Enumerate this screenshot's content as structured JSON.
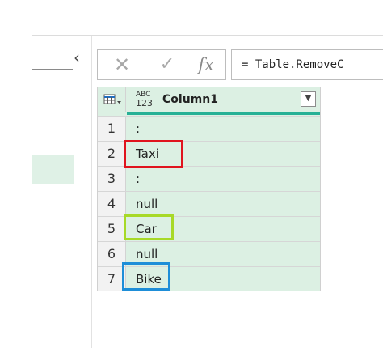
{
  "left_pane": {
    "collapse_glyph": "‹"
  },
  "formula_controls": {
    "cancel_glyph": "✕",
    "accept_glyph": "✓",
    "fx_label": "fx"
  },
  "formula_bar": {
    "text": "= Table.RemoveC"
  },
  "grid": {
    "type_icon_top": "ABC",
    "type_icon_bottom": "123",
    "column_header": "Column1",
    "filter_glyph": "▼",
    "rows": [
      {
        "num": "1",
        "value": ":"
      },
      {
        "num": "2",
        "value": "Taxi"
      },
      {
        "num": "3",
        "value": ":"
      },
      {
        "num": "4",
        "value": "null"
      },
      {
        "num": "5",
        "value": "Car"
      },
      {
        "num": "6",
        "value": "null"
      },
      {
        "num": "7",
        "value": "Bike"
      }
    ]
  },
  "highlights": {
    "red": "#e0141e",
    "lime": "#a7d927",
    "blue": "#1e8ed8"
  },
  "colors": {
    "accent": "#27b096",
    "cell_bg": "#dcf0e3"
  }
}
